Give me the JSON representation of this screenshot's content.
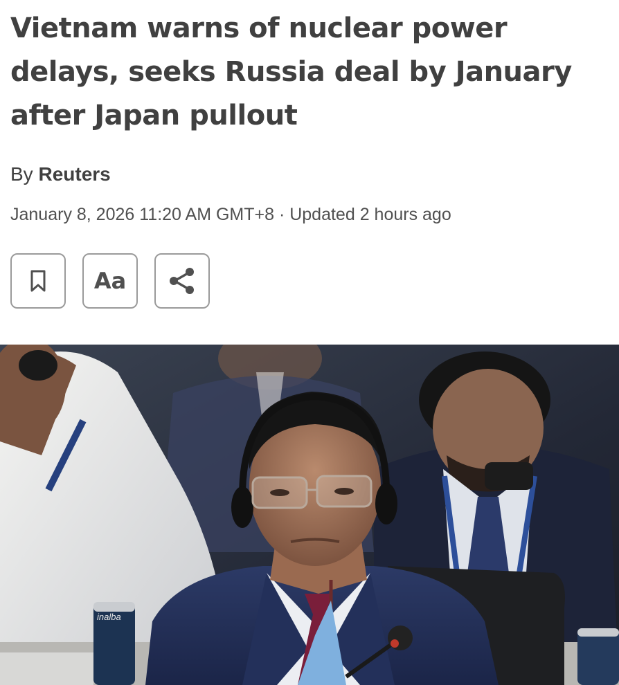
{
  "article": {
    "headline": "Vietnam warns of nuclear power delays, seeks Russia deal by January after Japan pullout",
    "byline_prefix": "By",
    "author": "Reuters",
    "dateline": "January 8, 2026 11:20 AM GMT+8 · Updated 2 hours ago"
  },
  "toolbar": {
    "font_size_label": "Aa"
  },
  "icons": {
    "bookmark": "bookmark-icon",
    "text_size": "text-size-icon",
    "share": "share-icon"
  },
  "photo": {
    "can_label": "inalba"
  },
  "colors": {
    "text": "#404040",
    "border": "#9a9a9a"
  }
}
